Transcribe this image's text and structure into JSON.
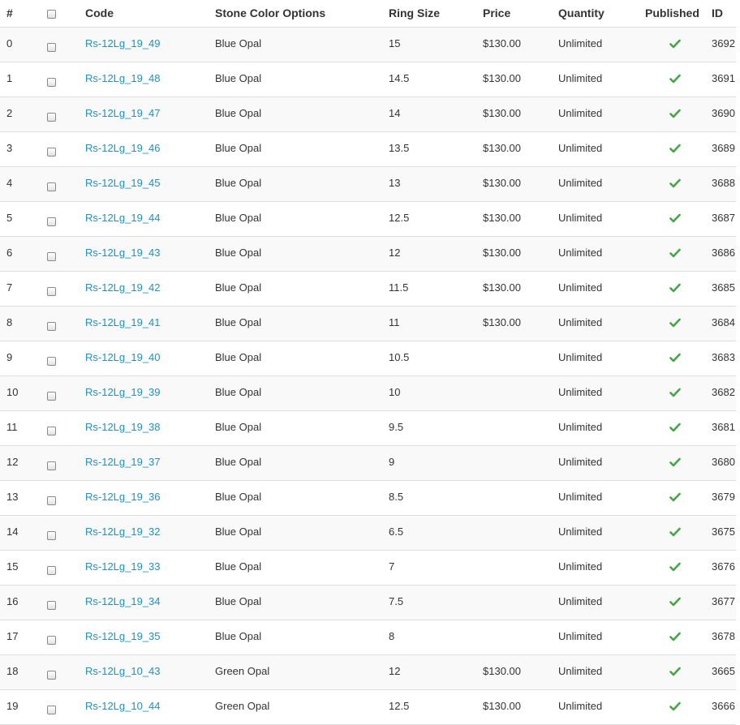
{
  "columns": {
    "num": "#",
    "code": "Code",
    "stone": "Stone Color Options",
    "size": "Ring Size",
    "price": "Price",
    "qty": "Quantity",
    "published": "Published",
    "id": "ID"
  },
  "colors": {
    "link": "#1f8fc4",
    "check": "#46a546",
    "row_stripe": "#f9f9f9",
    "border": "#dddddd"
  },
  "rows": [
    {
      "num": "0",
      "code": "Rs-12Lg_19_49",
      "stone": "Blue Opal",
      "size": "15",
      "price": "$130.00",
      "qty": "Unlimited",
      "published": true,
      "id": "3692"
    },
    {
      "num": "1",
      "code": "Rs-12Lg_19_48",
      "stone": "Blue Opal",
      "size": "14.5",
      "price": "$130.00",
      "qty": "Unlimited",
      "published": true,
      "id": "3691"
    },
    {
      "num": "2",
      "code": "Rs-12Lg_19_47",
      "stone": "Blue Opal",
      "size": "14",
      "price": "$130.00",
      "qty": "Unlimited",
      "published": true,
      "id": "3690"
    },
    {
      "num": "3",
      "code": "Rs-12Lg_19_46",
      "stone": "Blue Opal",
      "size": "13.5",
      "price": "$130.00",
      "qty": "Unlimited",
      "published": true,
      "id": "3689"
    },
    {
      "num": "4",
      "code": "Rs-12Lg_19_45",
      "stone": "Blue Opal",
      "size": "13",
      "price": "$130.00",
      "qty": "Unlimited",
      "published": true,
      "id": "3688"
    },
    {
      "num": "5",
      "code": "Rs-12Lg_19_44",
      "stone": "Blue Opal",
      "size": "12.5",
      "price": "$130.00",
      "qty": "Unlimited",
      "published": true,
      "id": "3687"
    },
    {
      "num": "6",
      "code": "Rs-12Lg_19_43",
      "stone": "Blue Opal",
      "size": "12",
      "price": "$130.00",
      "qty": "Unlimited",
      "published": true,
      "id": "3686"
    },
    {
      "num": "7",
      "code": "Rs-12Lg_19_42",
      "stone": "Blue Opal",
      "size": "11.5",
      "price": "$130.00",
      "qty": "Unlimited",
      "published": true,
      "id": "3685"
    },
    {
      "num": "8",
      "code": "Rs-12Lg_19_41",
      "stone": "Blue Opal",
      "size": "11",
      "price": "$130.00",
      "qty": "Unlimited",
      "published": true,
      "id": "3684"
    },
    {
      "num": "9",
      "code": "Rs-12Lg_19_40",
      "stone": "Blue Opal",
      "size": "10.5",
      "price": "",
      "qty": "Unlimited",
      "published": true,
      "id": "3683"
    },
    {
      "num": "10",
      "code": "Rs-12Lg_19_39",
      "stone": "Blue Opal",
      "size": "10",
      "price": "",
      "qty": "Unlimited",
      "published": true,
      "id": "3682"
    },
    {
      "num": "11",
      "code": "Rs-12Lg_19_38",
      "stone": "Blue Opal",
      "size": "9.5",
      "price": "",
      "qty": "Unlimited",
      "published": true,
      "id": "3681"
    },
    {
      "num": "12",
      "code": "Rs-12Lg_19_37",
      "stone": "Blue Opal",
      "size": "9",
      "price": "",
      "qty": "Unlimited",
      "published": true,
      "id": "3680"
    },
    {
      "num": "13",
      "code": "Rs-12Lg_19_36",
      "stone": "Blue Opal",
      "size": "8.5",
      "price": "",
      "qty": "Unlimited",
      "published": true,
      "id": "3679"
    },
    {
      "num": "14",
      "code": "Rs-12Lg_19_32",
      "stone": "Blue Opal",
      "size": "6.5",
      "price": "",
      "qty": "Unlimited",
      "published": true,
      "id": "3675"
    },
    {
      "num": "15",
      "code": "Rs-12Lg_19_33",
      "stone": "Blue Opal",
      "size": "7",
      "price": "",
      "qty": "Unlimited",
      "published": true,
      "id": "3676"
    },
    {
      "num": "16",
      "code": "Rs-12Lg_19_34",
      "stone": "Blue Opal",
      "size": "7.5",
      "price": "",
      "qty": "Unlimited",
      "published": true,
      "id": "3677"
    },
    {
      "num": "17",
      "code": "Rs-12Lg_19_35",
      "stone": "Blue Opal",
      "size": "8",
      "price": "",
      "qty": "Unlimited",
      "published": true,
      "id": "3678"
    },
    {
      "num": "18",
      "code": "Rs-12Lg_10_43",
      "stone": "Green Opal",
      "size": "12",
      "price": "$130.00",
      "qty": "Unlimited",
      "published": true,
      "id": "3665"
    },
    {
      "num": "19",
      "code": "Rs-12Lg_10_44",
      "stone": "Green Opal",
      "size": "12.5",
      "price": "$130.00",
      "qty": "Unlimited",
      "published": true,
      "id": "3666"
    }
  ]
}
